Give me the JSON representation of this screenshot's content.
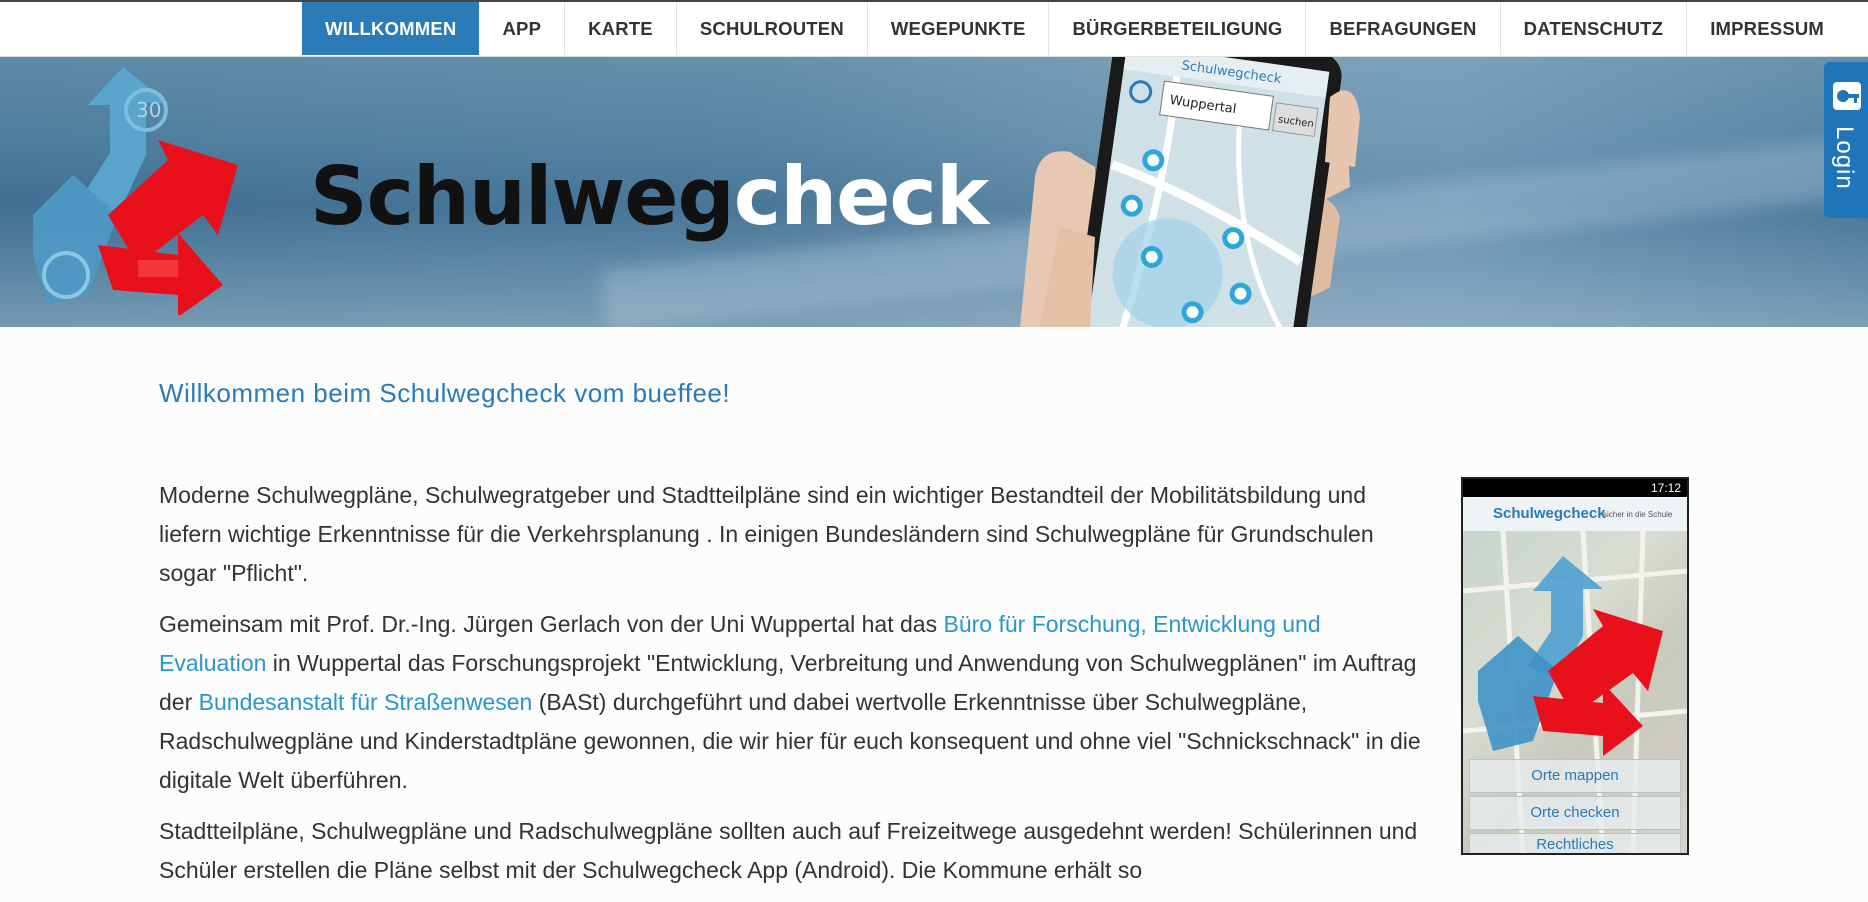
{
  "nav": {
    "items": [
      {
        "label": "WILLKOMMEN",
        "active": true
      },
      {
        "label": "APP"
      },
      {
        "label": "KARTE"
      },
      {
        "label": "SCHULROUTEN"
      },
      {
        "label": "WEGEPUNKTE"
      },
      {
        "label": "BÜRGERBETEILIGUNG"
      },
      {
        "label": "BEFRAGUNGEN"
      },
      {
        "label": "DATENSCHUTZ"
      },
      {
        "label": "IMPRESSUM"
      }
    ]
  },
  "banner": {
    "title_dark": "Schulweg",
    "title_light": "check",
    "logo_badge": "30",
    "phone_search": "Wuppertal",
    "phone_search_button": "suchen",
    "phone_app_title": "Schulwegcheck"
  },
  "login": {
    "label": "Login",
    "icon": "key-icon"
  },
  "main": {
    "heading": "Willkommen beim Schulwegcheck vom bueffee!",
    "p1": "Moderne Schulwegpläne, Schulwegratgeber und Stadtteilpläne sind ein wichtiger Bestandteil der Mobilitätsbildung und liefern wichtige Erkenntnisse für die Verkehrsplanung . In einigen Bundesländern sind Schulwegpläne für Grundschulen sogar \"Pflicht\".",
    "p2_a": "Gemeinsam mit Prof. Dr.-Ing. Jürgen Gerlach von der Uni Wuppertal hat das ",
    "p2_link1": "Büro für Forschung, Entwicklung und Evaluation",
    "p2_b": " in Wuppertal das Forschungsprojekt \"Entwicklung, Verbreitung und Anwendung von Schulwegplänen\" im Auftrag der ",
    "p2_link2": "Bundesanstalt für Straßenwesen",
    "p2_c": " (BASt) durchgeführt und dabei wertvolle Erkenntnisse über Schulwegpläne, Radschulwegpläne und Kinderstadtpläne gewonnen, die wir hier für euch konsequent und ohne viel \"Schnickschnack\" in die digitale Welt überführen.",
    "p3": "Stadtteilpläne, Schulwegpläne und Radschulwegpläne sollten auch auf Freizeitwege ausgedehnt werden! Schülerinnen und Schüler erstellen die Pläne selbst mit der Schulwegcheck App (Android). Die Kommune erhält so"
  },
  "app_shot": {
    "time": "17:12",
    "title": "Schulwegcheck",
    "title_sub": "sicher in die Schule",
    "buttons": [
      "Orte mappen",
      "Orte checken",
      "Rechtliches"
    ]
  },
  "colors": {
    "accent": "#2a7bb7",
    "link": "#2a96c9",
    "logo_blue": "#5aa6cf",
    "logo_red": "#e8111b"
  }
}
